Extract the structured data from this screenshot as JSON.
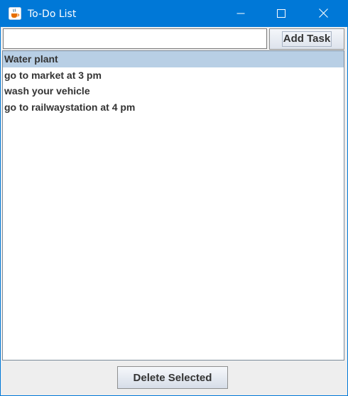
{
  "window": {
    "title": "To-Do List",
    "icon": "java-cup-icon",
    "controls": [
      "minimize-icon",
      "maximize-icon",
      "close-icon"
    ],
    "accent_color": "#0078d7"
  },
  "input": {
    "value": "",
    "placeholder": ""
  },
  "buttons": {
    "add_label": "Add Task",
    "delete_label": "Delete Selected"
  },
  "tasks": {
    "items": [
      {
        "label": "Water plant",
        "selected": true
      },
      {
        "label": "go to market at 3 pm",
        "selected": false
      },
      {
        "label": "wash your vehicle",
        "selected": false
      },
      {
        "label": "go to railwaystation at 4 pm",
        "selected": false
      }
    ],
    "selection_color": "#b8cfe5"
  }
}
